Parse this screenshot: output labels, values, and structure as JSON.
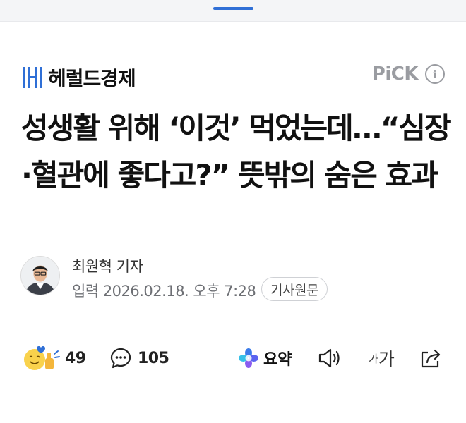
{
  "press": {
    "name": "헤럴드경제",
    "brand_color": "#2f6fd6",
    "logo_icon": "herald-h-logo-icon"
  },
  "pick": {
    "label": "PiCK",
    "info_icon": "info-icon"
  },
  "headline": "성생활 위해 ‘이것’ 먹었는데…“심장·혈관에 좋다고?” 뜻밖의 숨은 효과",
  "byline": {
    "reporter": "최원혁 기자",
    "published": "입력 2026.02.18. 오후 7:28",
    "original_button": "기사원문",
    "avatar_icon": "reporter-avatar"
  },
  "actions": {
    "reaction_count": "49",
    "comment_count": "105",
    "summary_label": "요약",
    "font_small": "가",
    "font_large": "가"
  },
  "colors": {
    "accent": "#2f6fd6",
    "muted": "#9a9ca1"
  }
}
